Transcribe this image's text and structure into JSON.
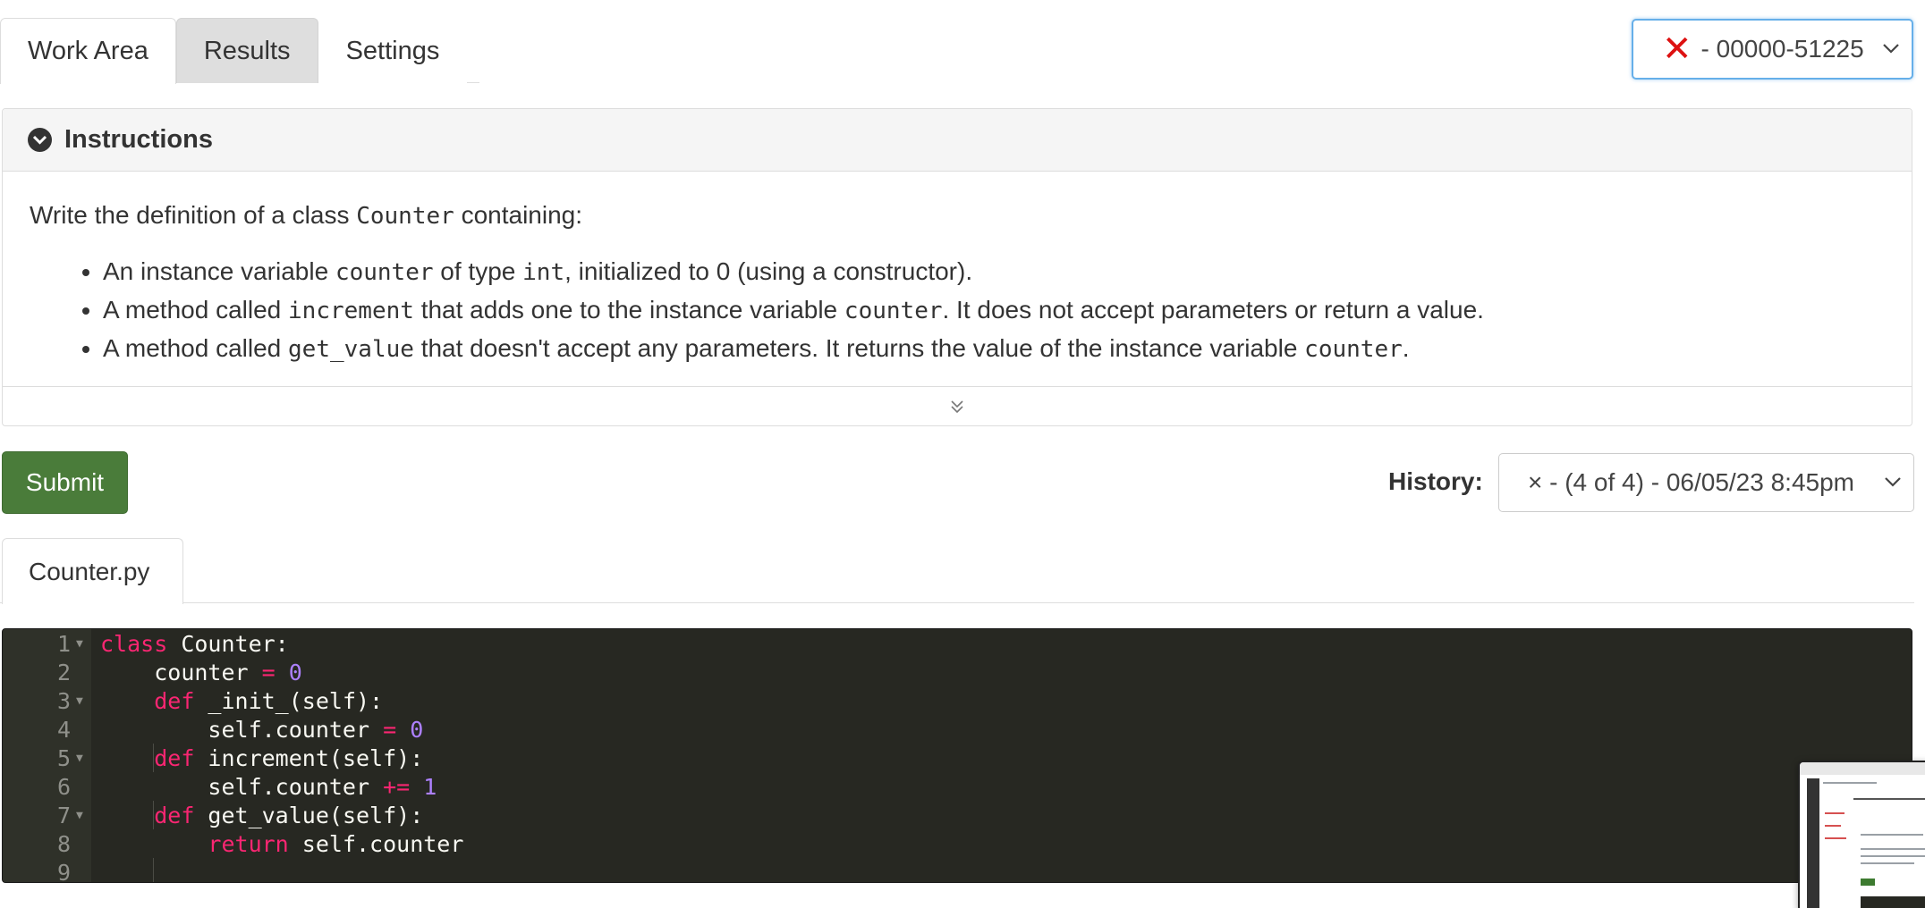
{
  "tabs": [
    {
      "label": "Work Area",
      "active": true
    },
    {
      "label": "Results",
      "active": false
    },
    {
      "label": "Settings",
      "active": false
    }
  ],
  "attempt": {
    "status_icon": "x-mark-icon",
    "status_color": "#dd1111",
    "label": "- 00000-51225"
  },
  "instructions": {
    "title": "Instructions",
    "intro_prefix": "Write the definition of a class ",
    "intro_code": "Counter",
    "intro_suffix": " containing:",
    "bullets": [
      {
        "t1": "An instance variable ",
        "c1": "counter",
        "t2": " of type ",
        "c2": "int",
        "t3": ", initialized to 0 (using a constructor)."
      },
      {
        "t1": "A method called ",
        "c1": "increment",
        "t2": " that adds one to the instance variable ",
        "c2": "counter",
        "t3": ". It does not accept parameters or return a value."
      },
      {
        "t1": "A method called ",
        "c1": "get_value",
        "t2": " that doesn't accept any parameters. It returns the value of the instance variable ",
        "c2": "counter",
        "t3": "."
      }
    ]
  },
  "toolbar": {
    "submit_label": "Submit",
    "submit_color": "#4a7c3a",
    "history_label": "History:",
    "history_value": "× - (4 of 4) - 06/05/23 8:45pm"
  },
  "file_tabs": [
    {
      "label": "Counter.py"
    }
  ],
  "editor": {
    "lines": [
      {
        "n": "1",
        "fold": true
      },
      {
        "n": "2",
        "fold": false
      },
      {
        "n": "3",
        "fold": true
      },
      {
        "n": "4",
        "fold": false
      },
      {
        "n": "5",
        "fold": true
      },
      {
        "n": "6",
        "fold": false
      },
      {
        "n": "7",
        "fold": true
      },
      {
        "n": "8",
        "fold": false
      },
      {
        "n": "9",
        "fold": false
      }
    ],
    "tokens": {
      "l1_kw": "class",
      "l1_rest": " Counter:",
      "l2_name": "counter ",
      "l2_op": "=",
      "l2_num": "0",
      "l3_kw": "def",
      "l3_rest": " _init_(self):",
      "l4_name": "self.counter ",
      "l4_op": "=",
      "l4_num": "0",
      "l5_kw": "def",
      "l5_rest": " increment(self):",
      "l6_name": "self.counter ",
      "l6_op": "+=",
      "l6_num": "1",
      "l7_kw": "def",
      "l7_rest": " get_value(self):",
      "l8_kw": "return",
      "l8_rest": " self.counter"
    }
  }
}
